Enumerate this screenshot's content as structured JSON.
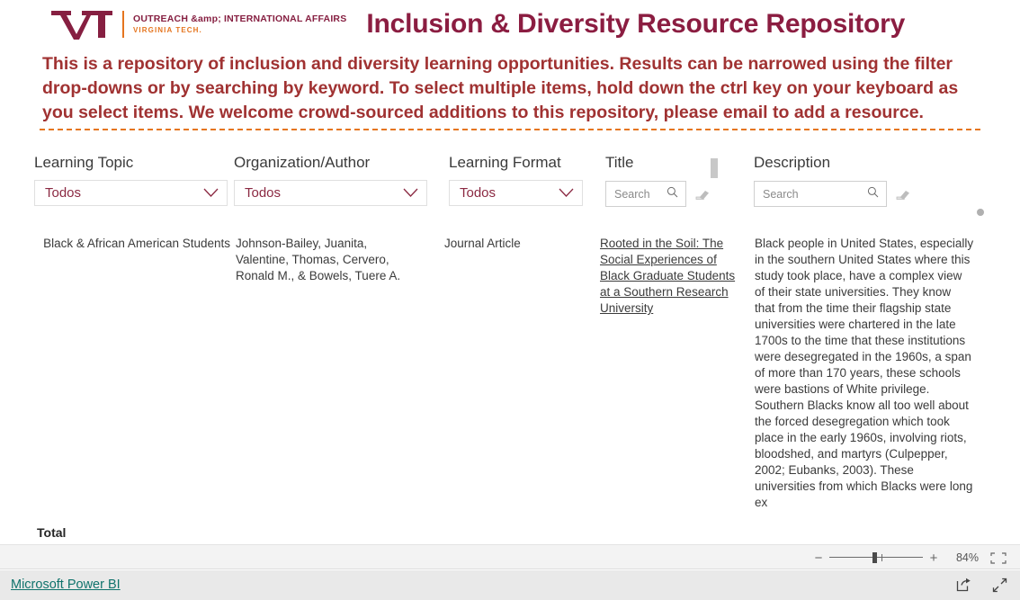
{
  "header": {
    "logo": {
      "mark_alt": "vt-logo",
      "line1": "OUTREACH &amp; INTERNATIONAL AFFAIRS",
      "line2": "VIRGINIA TECH."
    },
    "title": "Inclusion & Diversity Resource Repository",
    "intro": "This is a repository of inclusion and diversity learning opportunities. Results can be narrowed using the filter drop-downs or by searching by keyword. To select multiple items, hold down the ctrl key on your keyboard as you select items. We welcome crowd-sourced additions to this repository, please email to add a resource."
  },
  "filters": {
    "dropdowns": [
      {
        "label": "Learning Topic",
        "value": "Todos"
      },
      {
        "label": "Organization/Author",
        "value": "Todos"
      },
      {
        "label": "Learning Format",
        "value": "Todos"
      }
    ],
    "searches": [
      {
        "label": "Title",
        "value": "",
        "placeholder": "Search"
      },
      {
        "label": "Description",
        "value": "",
        "placeholder": "Search"
      }
    ]
  },
  "table": {
    "rows": [
      {
        "topic": "Black & African American Students",
        "author": "Johnson-Bailey, Juanita, Valentine, Thomas, Cervero, Ronald M., & Bowels, Tuere A.",
        "format": "Journal Article",
        "title": "Rooted in the Soil: The Social Experiences of Black Graduate Students at a Southern Research University",
        "description": "Black people in United States, especially in the\nsouthern United States where this study took place, have a complex view\nof their state universities. They know that from the time their flagship\nstate universities were chartered in the late 1700s to the time that these institutions were desegregated in the 1960s, a span of more than 170 years, these schools were bastions of White privilege. Southern Blacks know all too well about the forced desegregation which took place in the early 1960s, involving riots, bloodshed, and martyrs (Culpepper, 2002; Eubanks, 2003). These universities from which Blacks were long ex"
      }
    ],
    "total_label": "Total"
  },
  "toolbar": {
    "zoom_out_label": "−",
    "zoom_in_label": "+",
    "zoom_percent": "84%",
    "fit_icon": "fit-to-screen-icon"
  },
  "footer": {
    "powerbi_label": "Microsoft Power BI",
    "share_icon": "share-icon",
    "fullscreen_icon": "fullscreen-icon"
  },
  "colors": {
    "maroon": "#861f41",
    "orange": "#e5751f",
    "title_maroon": "#8b1d41",
    "intro_red": "#a03232",
    "teal": "#10736c"
  }
}
